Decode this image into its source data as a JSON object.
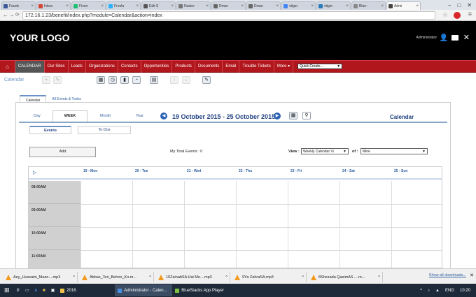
{
  "browser": {
    "tabs": [
      {
        "label": "Faceb",
        "color": "#3b5998"
      },
      {
        "label": "Inbox",
        "color": "#d44638"
      },
      {
        "label": "Fiverr",
        "color": "#1dbf73"
      },
      {
        "label": "Freela",
        "color": "#29b2fe"
      },
      {
        "label": "Edit S",
        "color": "#555555"
      },
      {
        "label": "Nadee",
        "color": "#777777"
      },
      {
        "label": "Down",
        "color": "#666666"
      },
      {
        "label": "Down",
        "color": "#666666"
      },
      {
        "label": "vtiger",
        "color": "#4285f4"
      },
      {
        "label": "vtiger",
        "color": "#2b7bb9"
      },
      {
        "label": "Blue-",
        "color": "#888888"
      },
      {
        "label": "Admi",
        "color": "#444444"
      }
    ],
    "url": "172.16.1.23/benefit/index.php?module=Calendar&action=index",
    "back_icon": "←",
    "forward_icon": "→",
    "reload_icon": "C",
    "min": "−",
    "max": "□",
    "close": "✕"
  },
  "header": {
    "logo": "YOUR LOGO",
    "user": "Administrator"
  },
  "nav": {
    "items": [
      "CALENDAR",
      "Our Sites",
      "Leads",
      "Organizations",
      "Contacts",
      "Opportunities",
      "Products",
      "Documents",
      "Email",
      "Trouble Tickets",
      "More ▾"
    ],
    "quick_create": "Quick Create..."
  },
  "breadcrumb": "Calendar",
  "tabs": {
    "calendar": "Calendar",
    "all_events": "All Events & Todos"
  },
  "views": {
    "day": "Day",
    "week": "WEEK",
    "month": "Month",
    "year": "Year"
  },
  "date_range": "19 October 2015 - 25 October 2015",
  "calendar_title": "Calendar",
  "subtabs": {
    "events": "Events",
    "todos": "To Dos"
  },
  "add_label": "Add",
  "total_events": "My Total Events : 0",
  "view_label": "View :",
  "view_select": "Weekly Calendar Vi",
  "of_label": "of :",
  "of_select": "Mine",
  "days": [
    "19 - Mon",
    "20 - Tue",
    "21 - Wed",
    "22 - Thu",
    "23 - Fri",
    "24 - Sat",
    "25 - Sun"
  ],
  "times": [
    "08:00AM",
    "09:00AM",
    "10:00AM",
    "11:00AM"
  ],
  "downloads": [
    "Aey_Hussaini_Maan....mp3",
    "Abbas_Teri_Behno_Ko.m...",
    "10ZainabSA Hai Me....mp3",
    "9Ya ZahraSA.mp3",
    "8Shezada QasimAS ....m..."
  ],
  "show_all": "Show all downloads...",
  "taskbar": {
    "apps": [
      "2016",
      "Administrator - Calen...",
      "BlueStacks App Player"
    ],
    "lang": "ENG",
    "time": "10:20"
  }
}
